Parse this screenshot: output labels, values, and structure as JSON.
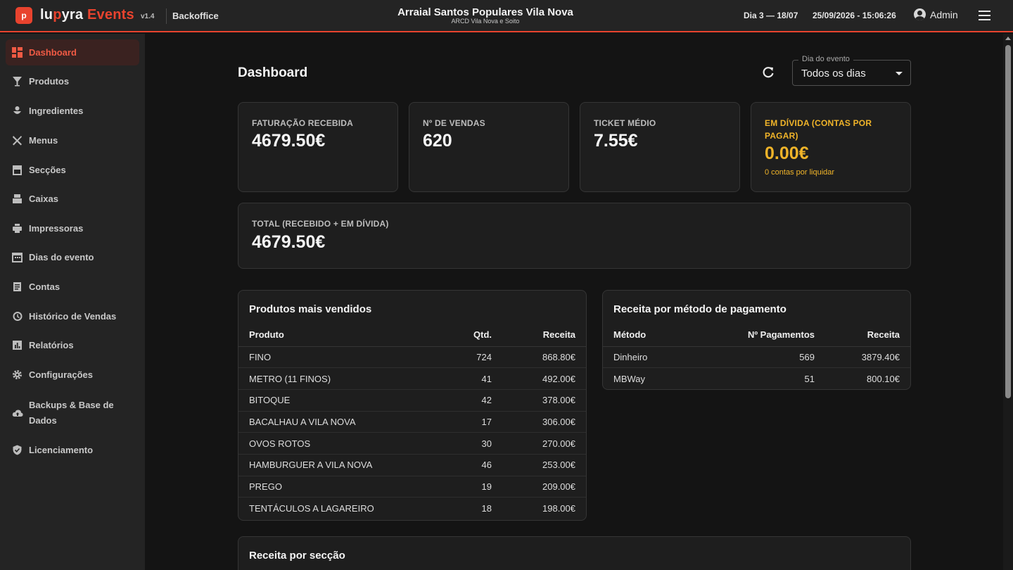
{
  "header": {
    "logo_letter": "p",
    "brand_part1": "lu",
    "brand_part2": "p",
    "brand_part3": "yra",
    "brand_events": "Events",
    "version": "v1.4",
    "section": "Backoffice",
    "event_title": "Arraial Santos Populares Vila Nova",
    "event_subtitle": "ARCD Vila Nova e Soito",
    "day_info": "Dia 3 — 18/07",
    "datetime": "25/09/2026 - 15:06:26",
    "user": "Admin"
  },
  "colors": {
    "accent": "#e8432e",
    "warning": "#f0b429",
    "background": "#141414",
    "sidebar": "#242424"
  },
  "sidebar": {
    "items": [
      {
        "label": "Dashboard",
        "icon": "dashboard-icon"
      },
      {
        "label": "Produtos",
        "icon": "cocktail-icon"
      },
      {
        "label": "Ingredientes",
        "icon": "ingredients-icon"
      },
      {
        "label": "Menus",
        "icon": "utensils-icon"
      },
      {
        "label": "Secções",
        "icon": "storefront-icon"
      },
      {
        "label": "Caixas",
        "icon": "register-icon"
      },
      {
        "label": "Impressoras",
        "icon": "printer-icon"
      },
      {
        "label": "Dias do evento",
        "icon": "calendar-icon"
      },
      {
        "label": "Contas",
        "icon": "receipt-icon"
      },
      {
        "label": "Histórico de Vendas",
        "icon": "history-icon"
      },
      {
        "label": "Relatórios",
        "icon": "chart-icon"
      },
      {
        "label": "Configurações",
        "icon": "gear-icon"
      },
      {
        "label": "Backups & Base de Dados",
        "icon": "cloud-upload-icon"
      },
      {
        "label": "Licenciamento",
        "icon": "shield-icon"
      }
    ]
  },
  "main": {
    "title": "Dashboard",
    "day_select": {
      "legend": "Dia do evento",
      "value": "Todos os dias"
    },
    "kpis": [
      {
        "label": "FATURAÇÃO RECEBIDA",
        "value": "4679.50€"
      },
      {
        "label": "Nº DE VENDAS",
        "value": "620"
      },
      {
        "label": "TICKET MÉDIO",
        "value": "7.55€"
      },
      {
        "label": "EM DÍVIDA (CONTAS POR PAGAR)",
        "value": "0.00€",
        "sub": "0 contas por liquidar"
      }
    ],
    "total": {
      "label": "TOTAL (RECEBIDO + EM DÍVIDA)",
      "value": "4679.50€"
    },
    "top_products": {
      "title": "Produtos mais vendidos",
      "columns": [
        "Produto",
        "Qtd.",
        "Receita"
      ],
      "rows": [
        [
          "FINO",
          "724",
          "868.80€"
        ],
        [
          "METRO (11 FINOS)",
          "41",
          "492.00€"
        ],
        [
          "BITOQUE",
          "42",
          "378.00€"
        ],
        [
          "BACALHAU A VILA NOVA",
          "17",
          "306.00€"
        ],
        [
          "OVOS ROTOS",
          "30",
          "270.00€"
        ],
        [
          "HAMBURGUER A VILA NOVA",
          "46",
          "253.00€"
        ],
        [
          "PREGO",
          "19",
          "209.00€"
        ],
        [
          "TENTÁCULOS A LAGAREIRO",
          "18",
          "198.00€"
        ]
      ]
    },
    "payment_methods": {
      "title": "Receita por método de pagamento",
      "columns": [
        "Método",
        "Nº Pagamentos",
        "Receita"
      ],
      "rows": [
        [
          "Dinheiro",
          "569",
          "3879.40€"
        ],
        [
          "MBWay",
          "51",
          "800.10€"
        ]
      ]
    },
    "sections": {
      "title": "Receita por secção"
    }
  }
}
